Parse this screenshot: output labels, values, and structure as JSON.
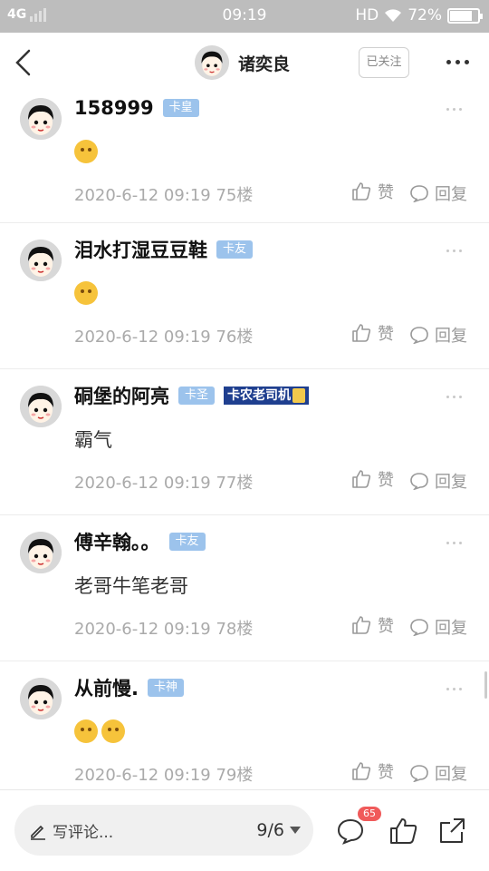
{
  "status_bar": {
    "network": "4G",
    "time": "09:19",
    "hd": "HD",
    "battery": "72%"
  },
  "header": {
    "title": "诸奕良",
    "follow_label": "已关注"
  },
  "comments": [
    {
      "name": "158999",
      "badge": "卡皇",
      "medal": "",
      "text": "",
      "emojis": 1,
      "time": "2020-6-12 09:19",
      "floor": "75楼"
    },
    {
      "name": "泪水打湿豆豆鞋",
      "badge": "卡友",
      "medal": "",
      "text": "",
      "emojis": 1,
      "time": "2020-6-12 09:19",
      "floor": "76楼"
    },
    {
      "name": "硐堡的阿亮",
      "badge": "卡圣",
      "medal": "卡农老司机",
      "text": "霸气",
      "emojis": 0,
      "time": "2020-6-12 09:19",
      "floor": "77楼"
    },
    {
      "name": "傅辛翰。。",
      "badge": "卡友",
      "medal": "",
      "text": "老哥牛笔老哥",
      "emojis": 0,
      "time": "2020-6-12 09:19",
      "floor": "78楼"
    },
    {
      "name": "从前慢.",
      "badge": "卡神",
      "medal": "",
      "text": "",
      "emojis": 2,
      "time": "2020-6-12 09:19",
      "floor": "79楼"
    }
  ],
  "actions": {
    "like": "赞",
    "reply": "回复"
  },
  "bottom_bar": {
    "write_placeholder": "写评论...",
    "page": "9/6",
    "comment_count": "65"
  },
  "colors": {
    "badge": "#9cc3ec",
    "status_bar": "#bdbdbd",
    "count_badge": "#f05a5a"
  }
}
